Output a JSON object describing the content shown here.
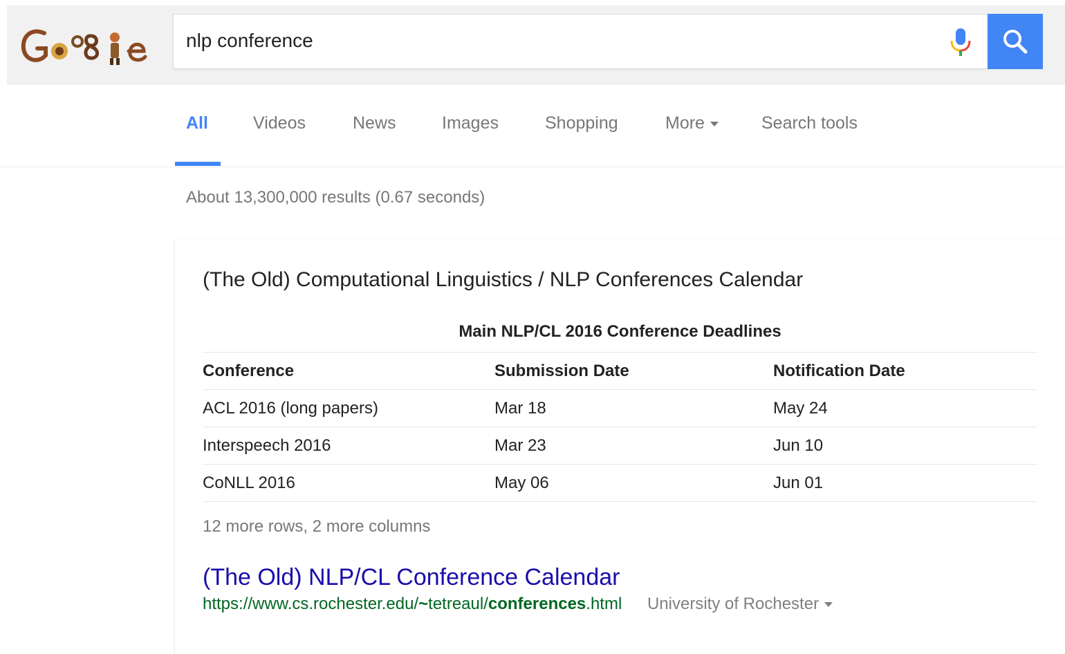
{
  "search": {
    "query": "nlp conference"
  },
  "tabs": [
    {
      "label": "All",
      "active": true
    },
    {
      "label": "Videos"
    },
    {
      "label": "News"
    },
    {
      "label": "Images"
    },
    {
      "label": "Shopping"
    },
    {
      "label": "More"
    },
    {
      "label": "Search tools"
    }
  ],
  "stats": "About 13,300,000 results (0.67 seconds)",
  "card": {
    "title": "(The Old) Computational Linguistics / NLP Conferences Calendar",
    "table_caption": "Main NLP/CL 2016 Conference Deadlines",
    "headers": [
      "Conference",
      "Submission Date",
      "Notification Date"
    ],
    "rows": [
      [
        "ACL 2016 (long papers)",
        "Mar 18",
        "May 24"
      ],
      [
        "Interspeech 2016",
        "Mar 23",
        "Jun 10"
      ],
      [
        "CoNLL 2016",
        "May 06",
        "Jun 01"
      ]
    ],
    "more_rows": "12 more rows, 2 more columns",
    "link_title": "(The Old) NLP/CL Conference Calendar",
    "url_prefix": "https://www.cs.rochester.edu/",
    "url_bold1": "~",
    "url_mid": "tetreaul/",
    "url_bold2": "conferences",
    "url_suffix": ".html",
    "source": "University of Rochester"
  },
  "colors": {
    "accent": "#4285f4",
    "link": "#1a0dab",
    "url": "#006621"
  },
  "icons": {
    "logo": "google-doodle-logo",
    "mic": "microphone-icon",
    "search": "search-icon"
  }
}
